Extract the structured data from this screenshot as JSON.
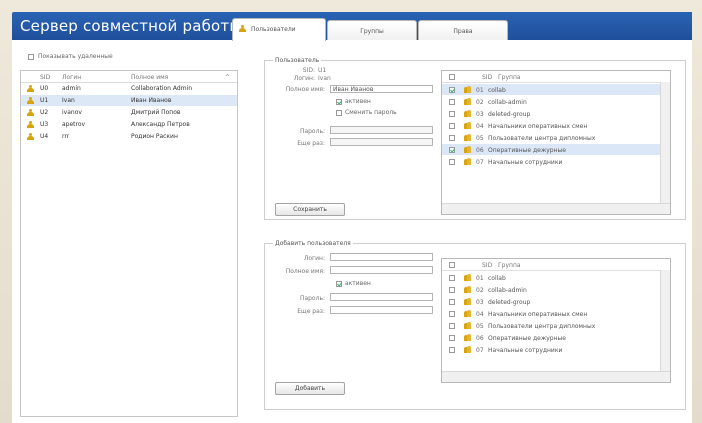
{
  "app": {
    "title": "Сервер совместной работы"
  },
  "tabs": [
    {
      "label": "Пользователи",
      "active": true
    },
    {
      "label": "Группы",
      "active": false
    },
    {
      "label": "Права",
      "active": false
    }
  ],
  "left": {
    "show_deleted_label": "Показывать удаленные",
    "columns": {
      "id": "SID",
      "login": "Логин",
      "fullname": "Полное имя"
    },
    "users": [
      {
        "id": "U0",
        "login": "admin",
        "fullname": "Collaboration Admin",
        "selected": false
      },
      {
        "id": "U1",
        "login": "Ivan",
        "fullname": "Иван Иванов",
        "selected": true
      },
      {
        "id": "U2",
        "login": "ivanov",
        "fullname": "Дмитрий Попов",
        "selected": false
      },
      {
        "id": "U3",
        "login": "apetrov",
        "fullname": "Александр Петров",
        "selected": false
      },
      {
        "id": "U4",
        "login": "rrr",
        "fullname": "Родион Раскин",
        "selected": false
      }
    ]
  },
  "user_form": {
    "legend": "Пользователь",
    "sid_label": "SID:",
    "sid_value": "U1",
    "login_label": "Логин:",
    "login_value": "Ivan",
    "fullname_label": "Полное имя:",
    "fullname_value": "Иван Иванов",
    "active_label": "активен",
    "change_password_label": "Сменить пароль",
    "password_label": "Пароль:",
    "password_repeat_label": "Еще раз:",
    "save_button": "Сохранить",
    "groups_header_id": "SID",
    "groups_header_name": "Группа"
  },
  "add_form": {
    "legend": "Добавить пользователя",
    "login_label": "Логин:",
    "fullname_label": "Полное имя:",
    "active_label": "активен",
    "password_label": "Пароль:",
    "password_repeat_label": "Еще раз:",
    "add_button": "Добавить",
    "groups_header_id": "SID",
    "groups_header_name": "Группа"
  },
  "groups": [
    {
      "id": "01",
      "name": "collab",
      "checked_edit": true,
      "checked_add": false
    },
    {
      "id": "02",
      "name": "collab-admin",
      "checked_edit": false,
      "checked_add": false
    },
    {
      "id": "03",
      "name": "deleted-group",
      "checked_edit": false,
      "checked_add": false
    },
    {
      "id": "04",
      "name": "Начальники оперативных смен",
      "checked_edit": false,
      "checked_add": false
    },
    {
      "id": "05",
      "name": "Пользователи центра дипломных",
      "checked_edit": false,
      "checked_add": false
    },
    {
      "id": "06",
      "name": "Оперативные дежурные",
      "checked_edit": true,
      "checked_add": false
    },
    {
      "id": "07",
      "name": "Начальные сотрудники",
      "checked_edit": false,
      "checked_add": false
    }
  ]
}
